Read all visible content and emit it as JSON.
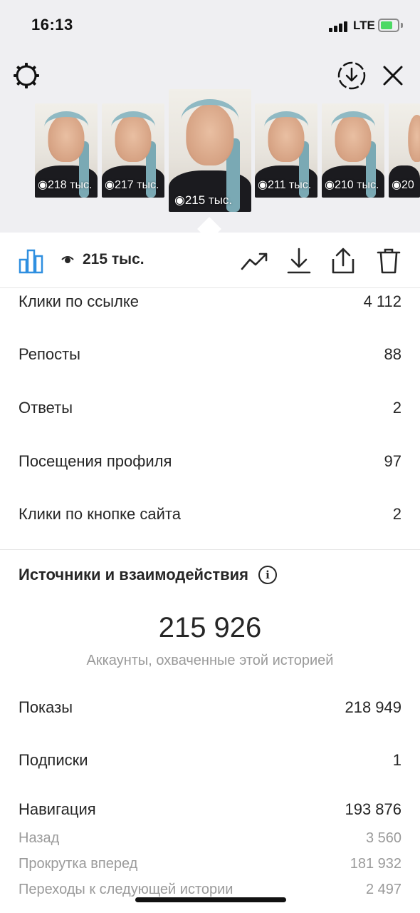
{
  "status_bar": {
    "time": "16:13",
    "network": "LTE"
  },
  "stories": [
    {
      "views": "218 тыс."
    },
    {
      "views": "217 тыс."
    },
    {
      "views": "215 тыс.",
      "active": true
    },
    {
      "views": "211 тыс."
    },
    {
      "views": "210 тыс."
    },
    {
      "views": "20"
    }
  ],
  "toolbar": {
    "views": "215 тыс."
  },
  "interactions": [
    {
      "label": "Клики по ссылке",
      "value": "4 112"
    },
    {
      "label": "Репосты",
      "value": "88"
    },
    {
      "label": "Ответы",
      "value": "2"
    },
    {
      "label": "Посещения профиля",
      "value": "97"
    },
    {
      "label": "Клики по кнопке сайта",
      "value": "2"
    }
  ],
  "discovery": {
    "title": "Источники и взаимодействия",
    "reach": "215 926",
    "reach_label": "Аккаунты, охваченные этой историей",
    "impressions": {
      "label": "Показы",
      "value": "218 949"
    },
    "follows": {
      "label": "Подписки",
      "value": "1"
    },
    "navigation": {
      "label": "Навигация",
      "value": "193 876"
    },
    "navigation_details": [
      {
        "label": "Назад",
        "value": "3 560"
      },
      {
        "label": "Прокрутка вперед",
        "value": "181 932"
      },
      {
        "label": "Переходы к следующей истории",
        "value": "2 497"
      }
    ]
  },
  "colors": {
    "accent": "#2f8fe0",
    "text": "#262626",
    "muted": "#9a9a9a",
    "top_bg": "#efeff2"
  },
  "icons": [
    "settings-icon",
    "download-circle-icon",
    "close-icon",
    "bar-chart-icon",
    "eye-icon",
    "trend-icon",
    "download-icon",
    "share-icon",
    "trash-icon",
    "info-icon"
  ]
}
